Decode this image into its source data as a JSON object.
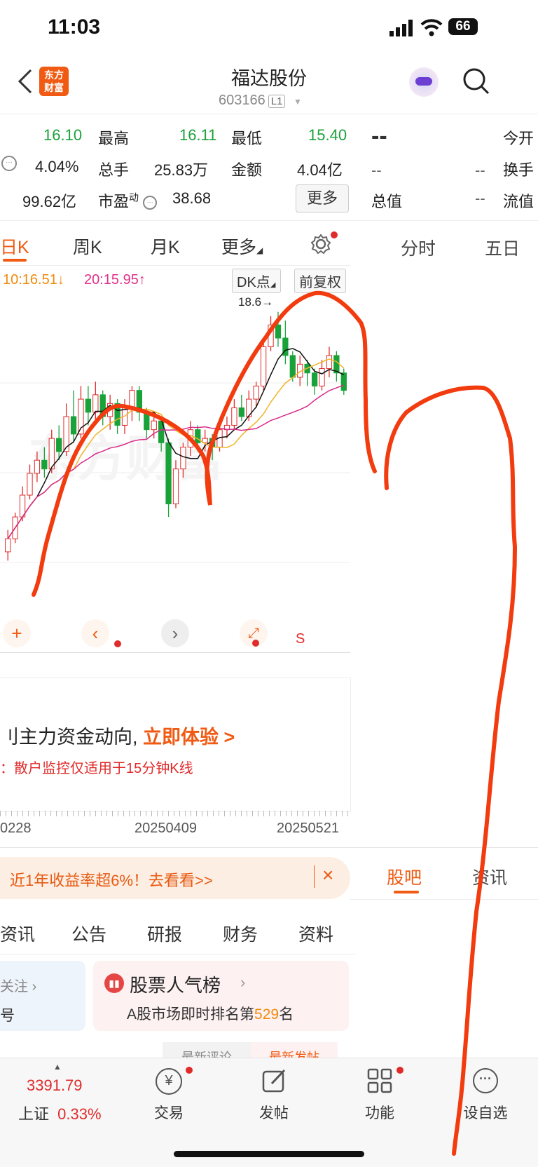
{
  "status": {
    "time": "11:03",
    "battery": "66"
  },
  "header": {
    "logo_line1": "东方",
    "logo_line2": "财富",
    "title": "福达股份",
    "code": "603166",
    "level": "L1"
  },
  "quote": {
    "open_value": "16.10",
    "high_label": "最高",
    "high_value": "16.11",
    "low_label": "最低",
    "low_value": "15.40",
    "change_pct": "4.04%",
    "volume_label": "总手",
    "volume_value": "25.83万",
    "amount_label": "金额",
    "amount_value": "4.04亿",
    "mktcap_value": "99.62亿",
    "pe_label": "市盈",
    "pe_sup": "动",
    "pe_value": "38.68",
    "more_button": "更多"
  },
  "right_panel": {
    "price": "--",
    "today_open": "今开",
    "turnover": "换手",
    "total_value": "总值",
    "float_value": "流值",
    "dash": "--",
    "tab_fenshi": "分时",
    "tab_wuri": "五日"
  },
  "period_tabs": {
    "day": "日K",
    "week": "周K",
    "month": "月K",
    "more": "更多"
  },
  "ma_legend": {
    "ma10": "10:16.51↓",
    "ma20": "20:15.95↑"
  },
  "chart_tags": {
    "dk": "DK点",
    "fq": "前复权",
    "high_mark": "18.60"
  },
  "chart_tools": {
    "s_label": "S"
  },
  "promo": {
    "main_prefix": "刂主力资金动向,",
    "main_cta": "立即体验 >",
    "sub": "：散户监控仅适用于15分钟K线"
  },
  "dates": {
    "d1": "0228",
    "d2": "20250409",
    "d3": "20250521"
  },
  "banner": {
    "text": "近1年收益率超6%！去看看>>",
    "close": "×"
  },
  "right_tabs": {
    "guba": "股吧",
    "zixun": "资讯"
  },
  "info_tabs": [
    "资讯",
    "公告",
    "研报",
    "财务",
    "资料"
  ],
  "cards": {
    "left_title": "关注",
    "left_sub": "号",
    "right_title": "股票人气榜",
    "right_sub_prefix": "A股市场即时排名第",
    "rank": "529",
    "rank_suffix": "名",
    "tab_a": "最新评论",
    "tab_b": "最新发帖"
  },
  "bottom_bar": {
    "index_value": "3391.79",
    "index_name": "上证",
    "index_change": "0.33%",
    "trade": "交易",
    "post": "发帖",
    "functions": "功能",
    "watchlist": "设自选"
  },
  "chart_data": {
    "type": "candlestick",
    "x_start": "0228",
    "x_mid": "20250409",
    "x_end": "20250521",
    "max_label": 18.6,
    "candles": [
      {
        "o": 13.1,
        "c": 13.4,
        "h": 13.6,
        "l": 12.9
      },
      {
        "o": 13.4,
        "c": 13.9,
        "h": 14.0,
        "l": 13.3
      },
      {
        "o": 13.9,
        "c": 14.4,
        "h": 14.6,
        "l": 13.8
      },
      {
        "o": 14.4,
        "c": 14.9,
        "h": 15.1,
        "l": 14.3
      },
      {
        "o": 14.9,
        "c": 15.2,
        "h": 15.4,
        "l": 14.7
      },
      {
        "o": 15.2,
        "c": 15.0,
        "h": 15.5,
        "l": 14.8
      },
      {
        "o": 15.0,
        "c": 15.7,
        "h": 15.9,
        "l": 14.9
      },
      {
        "o": 15.7,
        "c": 15.4,
        "h": 16.0,
        "l": 15.2
      },
      {
        "o": 15.4,
        "c": 16.2,
        "h": 16.5,
        "l": 15.3
      },
      {
        "o": 16.2,
        "c": 15.8,
        "h": 16.8,
        "l": 15.6
      },
      {
        "o": 15.8,
        "c": 16.6,
        "h": 16.9,
        "l": 15.7
      },
      {
        "o": 16.6,
        "c": 16.3,
        "h": 16.9,
        "l": 16.0
      },
      {
        "o": 16.3,
        "c": 16.7,
        "h": 17.0,
        "l": 16.1
      },
      {
        "o": 16.7,
        "c": 16.2,
        "h": 16.8,
        "l": 16.0
      },
      {
        "o": 16.2,
        "c": 16.5,
        "h": 16.7,
        "l": 15.9
      },
      {
        "o": 16.5,
        "c": 16.0,
        "h": 16.6,
        "l": 15.8
      },
      {
        "o": 16.0,
        "c": 16.4,
        "h": 16.6,
        "l": 15.8
      },
      {
        "o": 16.4,
        "c": 16.8,
        "h": 16.9,
        "l": 16.1
      },
      {
        "o": 16.8,
        "c": 16.3,
        "h": 16.9,
        "l": 16.1
      },
      {
        "o": 16.3,
        "c": 15.9,
        "h": 16.4,
        "l": 15.7
      },
      {
        "o": 15.9,
        "c": 16.1,
        "h": 16.3,
        "l": 15.7
      },
      {
        "o": 16.1,
        "c": 15.6,
        "h": 16.2,
        "l": 15.4
      },
      {
        "o": 15.6,
        "c": 14.2,
        "h": 15.7,
        "l": 13.9
      },
      {
        "o": 14.2,
        "c": 15.0,
        "h": 15.2,
        "l": 14.1
      },
      {
        "o": 15.0,
        "c": 15.5,
        "h": 15.6,
        "l": 14.8
      },
      {
        "o": 15.5,
        "c": 15.9,
        "h": 16.1,
        "l": 15.3
      },
      {
        "o": 15.9,
        "c": 15.6,
        "h": 16.0,
        "l": 15.4
      },
      {
        "o": 15.6,
        "c": 15.7,
        "h": 15.9,
        "l": 15.4
      },
      {
        "o": 15.7,
        "c": 15.5,
        "h": 15.8,
        "l": 15.2
      },
      {
        "o": 15.5,
        "c": 15.9,
        "h": 16.1,
        "l": 15.4
      },
      {
        "o": 15.9,
        "c": 16.0,
        "h": 16.2,
        "l": 15.7
      },
      {
        "o": 16.0,
        "c": 16.4,
        "h": 16.6,
        "l": 15.9
      },
      {
        "o": 16.4,
        "c": 16.2,
        "h": 16.7,
        "l": 16.1
      },
      {
        "o": 16.2,
        "c": 16.6,
        "h": 16.8,
        "l": 16.1
      },
      {
        "o": 16.6,
        "c": 16.9,
        "h": 17.0,
        "l": 16.4
      },
      {
        "o": 16.9,
        "c": 17.8,
        "h": 17.9,
        "l": 16.8
      },
      {
        "o": 17.8,
        "c": 18.3,
        "h": 18.5,
        "l": 17.7
      },
      {
        "o": 18.3,
        "c": 18.0,
        "h": 18.6,
        "l": 17.8
      },
      {
        "o": 18.0,
        "c": 17.6,
        "h": 18.4,
        "l": 17.4
      },
      {
        "o": 17.6,
        "c": 17.1,
        "h": 17.7,
        "l": 17.0
      },
      {
        "o": 17.1,
        "c": 17.4,
        "h": 17.6,
        "l": 16.9
      },
      {
        "o": 17.4,
        "c": 17.2,
        "h": 17.5,
        "l": 16.9
      },
      {
        "o": 17.2,
        "c": 16.9,
        "h": 17.3,
        "l": 16.7
      },
      {
        "o": 16.9,
        "c": 17.3,
        "h": 17.5,
        "l": 16.8
      },
      {
        "o": 17.3,
        "c": 17.6,
        "h": 17.8,
        "l": 17.1
      },
      {
        "o": 17.6,
        "c": 17.2,
        "h": 17.7,
        "l": 17.0
      },
      {
        "o": 17.2,
        "c": 16.8,
        "h": 17.3,
        "l": 16.7
      }
    ],
    "ylim": [
      12.6,
      18.9
    ]
  }
}
